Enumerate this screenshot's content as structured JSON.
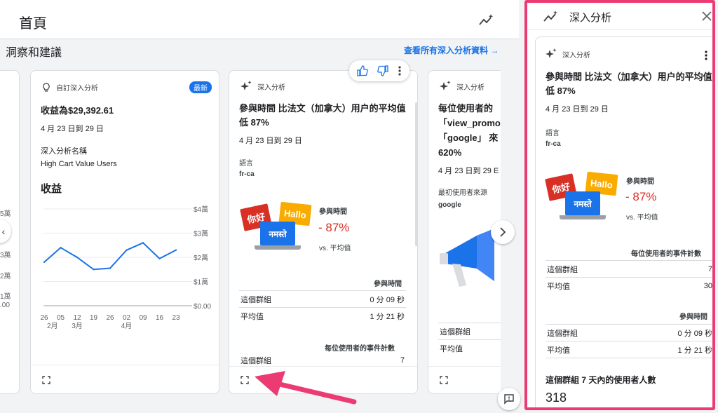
{
  "header": {
    "title": "首頁"
  },
  "section": {
    "title": "洞察和建議",
    "view_all": "查看所有深入分析資料 →"
  },
  "card1": {
    "type_label": "自訂深入分析",
    "badge": "最新",
    "headline": "收益為$29,392.61",
    "date": "4 月 23 日到 29 日",
    "name_label": "深入分析名稱",
    "name_value": "High Cart Value Users",
    "chart_title": "收益",
    "chart_data": {
      "type": "line",
      "x": [
        "2月26",
        "3月05",
        "12",
        "19",
        "26",
        "4月02",
        "09",
        "16",
        "23"
      ],
      "values": [
        1.8,
        2.4,
        2.0,
        1.5,
        1.55,
        2.3,
        2.6,
        1.95,
        2.3
      ],
      "ylim": [
        0,
        4
      ],
      "yticks": [
        "$4萬",
        "$3萬",
        "$2萬",
        "$1萬",
        "$0.00"
      ],
      "xticks": [
        "26",
        "05",
        "12",
        "19",
        "26",
        "02",
        "09",
        "16",
        "23"
      ],
      "xsublabels": [
        "2月",
        "3月",
        "4月"
      ],
      "left_ticks": [
        "5萬",
        "4萬",
        "3萬",
        "2萬",
        "1萬",
        ".00"
      ],
      "color": "#1a73e8"
    }
  },
  "card2": {
    "type_label": "深入分析",
    "headline": "參與時間 比法文（加拿大）用户的平均值低 87%",
    "date": "4 月 23 日到 29 日",
    "dim_label": "語言",
    "dim_value": "fr-ca",
    "metric_label": "參與時間",
    "metric_value": "- 87%",
    "metric_sub": "vs. 平均值",
    "table_title": "參與時間",
    "rows": [
      {
        "label": "這個群組",
        "value": "0 分 09 秒"
      },
      {
        "label": "平均值",
        "value": "1 分 21 秒"
      }
    ],
    "table2_title": "每位使用者的事件計數",
    "row3": {
      "label": "這個群組",
      "value": "7"
    },
    "tiles": {
      "ni_hao": "你好",
      "hallo": "Hallo",
      "namaste": "नमस्ते"
    }
  },
  "card3": {
    "type_label": "深入分析",
    "headline_lines": [
      "每位使用者的",
      "「view_promo",
      "「google」 來",
      "620%"
    ],
    "date": "4 月 23 日到 29 E",
    "dim_label": "最初使用者來源",
    "dim_value": "google",
    "rows": [
      {
        "label": "這個群組"
      },
      {
        "label": "平均值"
      }
    ]
  },
  "panel": {
    "title": "深入分析",
    "type_label": "深入分析",
    "headline": "參與時間 比法文（加拿大）用户的平均值低 87%",
    "date": "4 月 23 日到 29 日",
    "dim_label": "語言",
    "dim_value": "fr-ca",
    "metric_label": "參與時間",
    "metric_value": "- 87%",
    "metric_sub": "vs. 平均值",
    "t1_title": "每位使用者的事件計數",
    "t1_rows": [
      {
        "label": "這個群組",
        "value": "7"
      },
      {
        "label": "平均值",
        "value": "30"
      }
    ],
    "t2_title": "參與時間",
    "t2_rows": [
      {
        "label": "這個群組",
        "value": "0 分 09 秒"
      },
      {
        "label": "平均值",
        "value": "1 分 21 秒"
      }
    ],
    "users_label": "這個群組 7 天內的使用者人數",
    "users_value": "318"
  },
  "colors": {
    "accent": "#1a73e8",
    "highlight": "#ec3a72",
    "negative": "#d93025"
  }
}
